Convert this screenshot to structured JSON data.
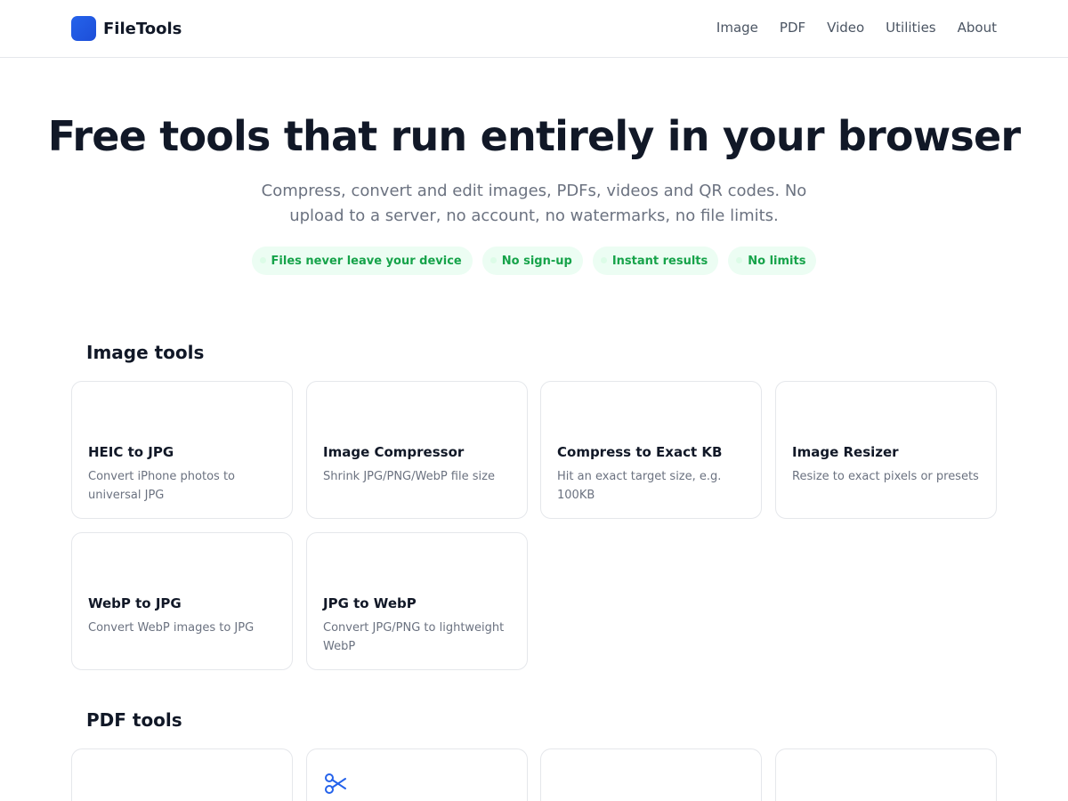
{
  "header": {
    "brand": "FileTools",
    "nav": [
      "Image",
      "PDF",
      "Video",
      "Utilities",
      "About"
    ]
  },
  "hero": {
    "title": "Free tools that run entirely in your browser",
    "subtitle": "Compress, convert and edit images, PDFs, videos and QR codes. No upload to a server, no account, no watermarks, no file limits.",
    "pills": [
      "Files never leave your device",
      "No sign-up",
      "Instant results",
      "No limits"
    ]
  },
  "image_tools": {
    "heading": "Image tools",
    "cards": [
      {
        "title": "HEIC to JPG",
        "desc": "Convert iPhone photos to universal JPG"
      },
      {
        "title": "Image Compressor",
        "desc": "Shrink JPG/PNG/WebP file size"
      },
      {
        "title": "Compress to Exact KB",
        "desc": "Hit an exact target size, e.g. 100KB"
      },
      {
        "title": "Image Resizer",
        "desc": "Resize to exact pixels or presets"
      },
      {
        "title": "WebP to JPG",
        "desc": "Convert WebP images to JPG"
      },
      {
        "title": "JPG to WebP",
        "desc": "Convert JPG/PNG to lightweight WebP"
      }
    ]
  },
  "pdf_tools": {
    "heading": "PDF tools",
    "icons": [
      "blank",
      "scissors-icon",
      "blank",
      "blank"
    ]
  },
  "colors": {
    "accent": "#2563eb",
    "pill_bg": "#ecfdf3",
    "pill_text": "#16a34a",
    "border": "#e5e7eb"
  }
}
